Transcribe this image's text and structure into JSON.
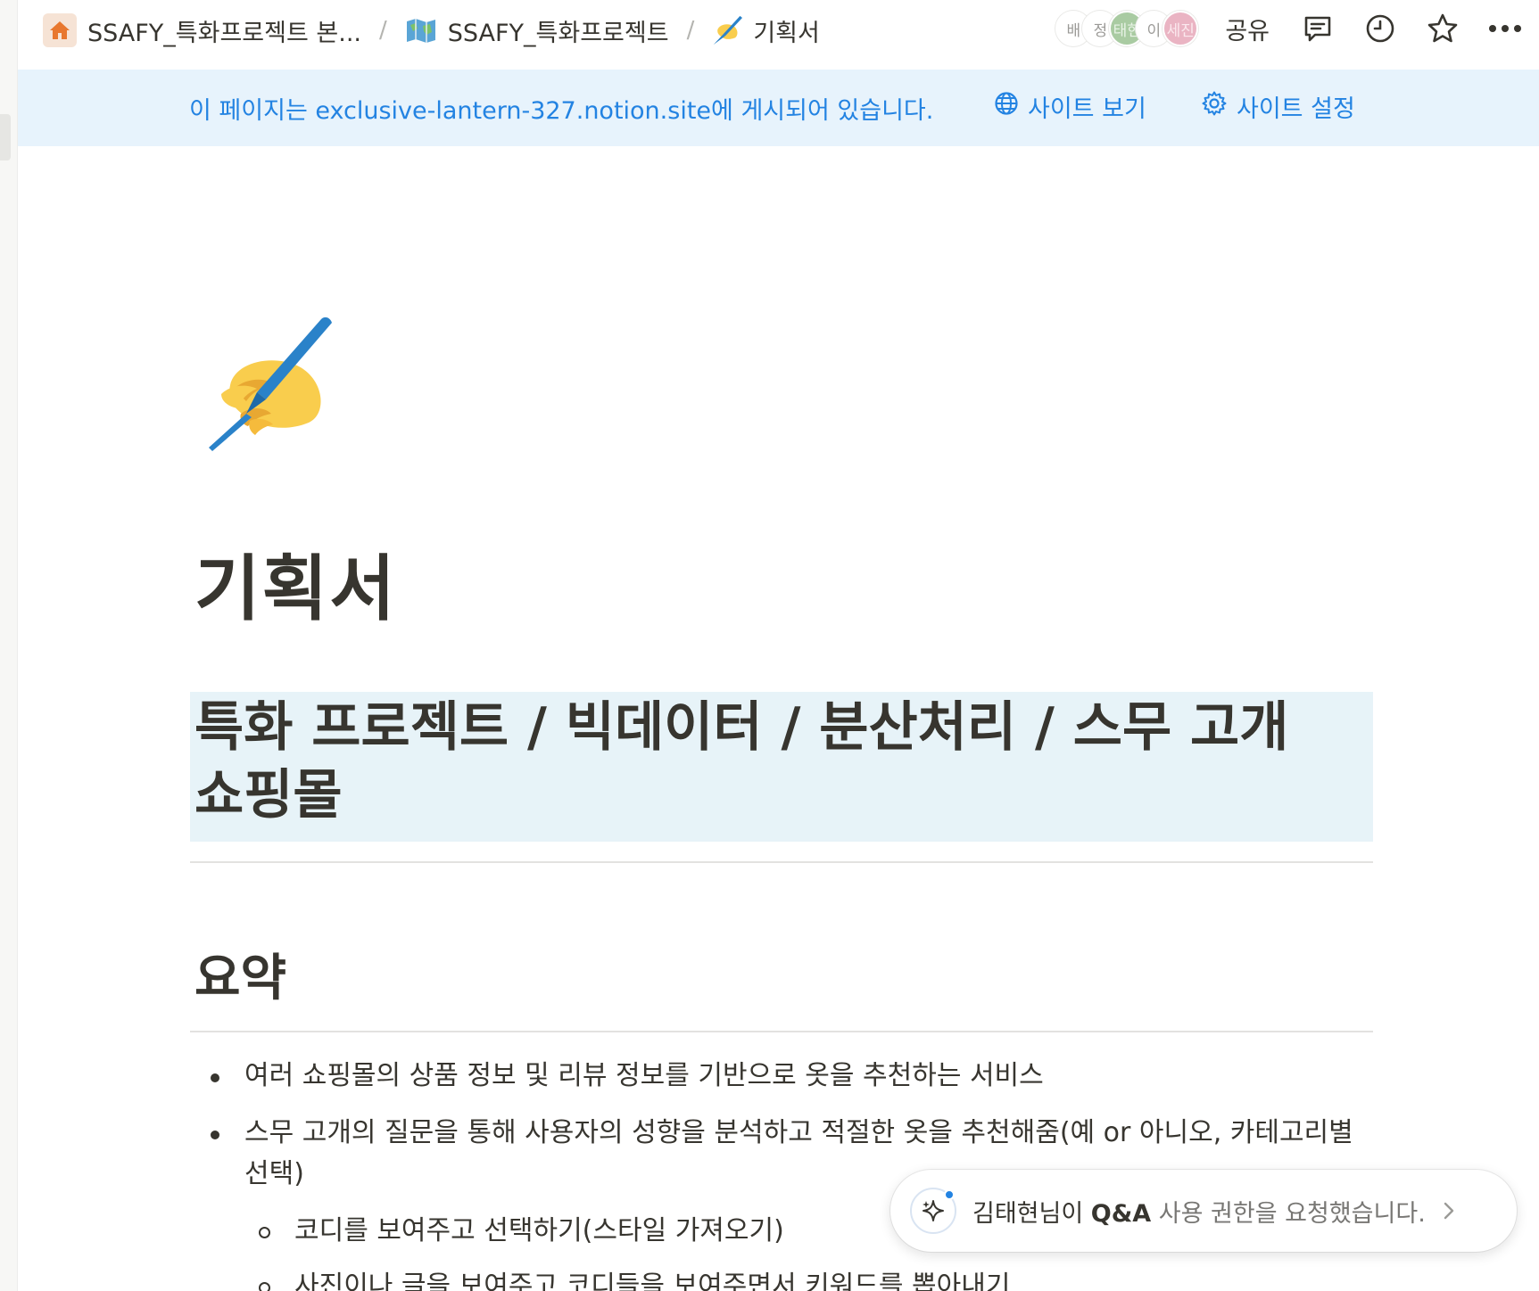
{
  "breadcrumbs": [
    {
      "label": "SSAFY_특화프로젝트 본...",
      "icon": "home-icon"
    },
    {
      "label": "SSAFY_특화프로젝트",
      "icon": "map-icon"
    },
    {
      "label": "기획서",
      "icon": "writing-hand-icon"
    }
  ],
  "breadcrumb_separator": "/",
  "avatars": [
    {
      "label": "배",
      "color": "#ffffff"
    },
    {
      "label": "정",
      "color": "#ffffff"
    },
    {
      "label": "태현",
      "color": "#a9cba2"
    },
    {
      "label": "이",
      "color": "#ffffff"
    },
    {
      "label": "세진",
      "color": "#eab4c3"
    }
  ],
  "toolbar": {
    "share_label": "공유",
    "icons": [
      "comment-icon",
      "clock-icon",
      "star-icon",
      "more-icon"
    ]
  },
  "banner": {
    "text": "이 페이지는 exclusive-lantern-327.notion.site에 게시되어 있습니다.",
    "view_site_label": "사이트 보기",
    "site_settings_label": "사이트 설정",
    "color": "#2383e2",
    "background": "#e7f3fc"
  },
  "page": {
    "icon": "writing-hand-icon",
    "title": "기획서",
    "heading1": "특화 프로젝트 / 빅데이터 / 분산처리 / 스무 고개 쇼핑몰",
    "heading1_background": "#e7f3f8",
    "section_title": "요약",
    "bullets": [
      {
        "text": "여러 쇼핑몰의 상품 정보 및 리뷰 정보를 기반으로 옷을 추천하는 서비스"
      },
      {
        "text": "스무 고개의 질문을 통해 사용자의 성향을 분석하고 적절한 옷을 추천해줌(예 or 아니오, 카테고리별 선택)"
      }
    ],
    "sub_bullets": [
      {
        "text": "코디를 보여주고 선택하기(스타일 가져오기)"
      },
      {
        "text": "사진이나 글을 보여주고 코디들을 보여주면서 키워드를 뽑아내기"
      }
    ]
  },
  "toast": {
    "name": "김태현님이",
    "feature": "Q&A",
    "message": "사용 권한을 요청했습니다.",
    "icon": "ai-sparkle-icon"
  }
}
